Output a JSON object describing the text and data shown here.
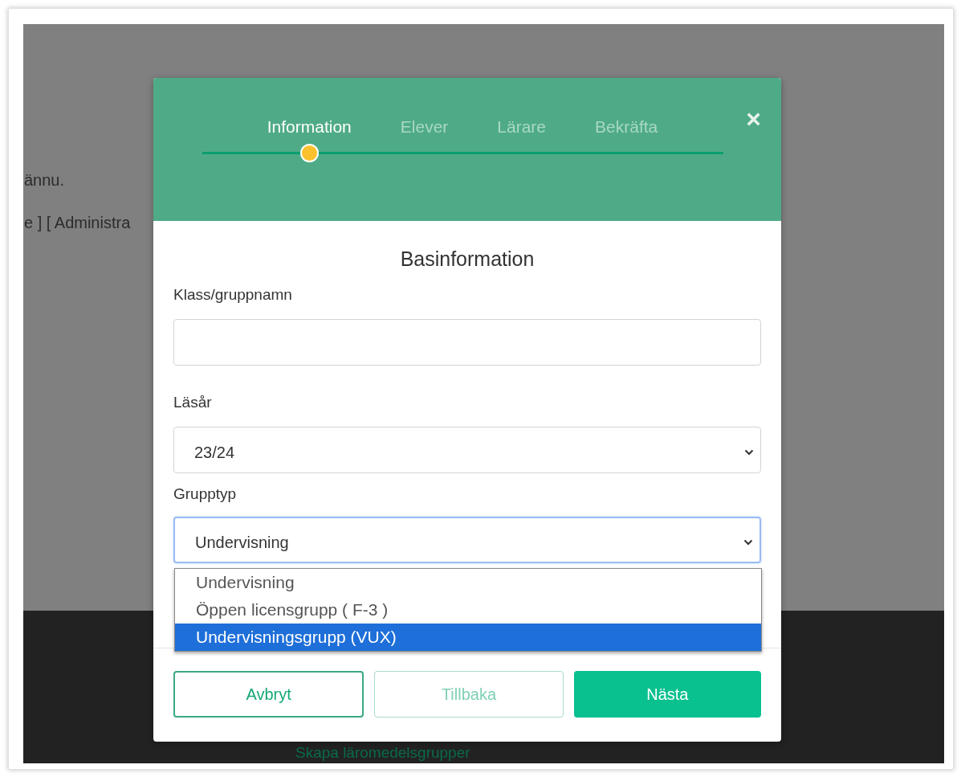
{
  "background": {
    "lines": [
      "ännu.",
      "e ] [ Administra"
    ],
    "link": "Skapa läromedelsgrupper"
  },
  "modal": {
    "steps": [
      {
        "label": "Information",
        "selected": true
      },
      {
        "label": "Elever",
        "selected": false
      },
      {
        "label": "Lärare",
        "selected": false
      },
      {
        "label": "Bekräfta",
        "selected": false
      }
    ],
    "close": "×",
    "heading": "Basinformation",
    "fields": [
      {
        "kind": "text",
        "label": "Klass/gruppnamn",
        "focused": false
      },
      {
        "kind": "select",
        "label": "Läsår",
        "value": "23/24",
        "focused": false
      },
      {
        "kind": "select",
        "label": "Grupptyp",
        "value": "Undervisning",
        "focused": true
      }
    ],
    "dropdown": [
      {
        "label": "Undervisning",
        "selected": false
      },
      {
        "label": "Öppen licensgrupp ( F-3 )",
        "selected": false
      },
      {
        "label": "Undervisningsgrupp (VUX)",
        "selected": true
      }
    ],
    "buttons": [
      {
        "label": "Avbryt",
        "kind": "outline",
        "disabled": false
      },
      {
        "label": "Tillbaka",
        "kind": "outline",
        "disabled": true
      },
      {
        "label": "Nästa",
        "kind": "primary",
        "disabled": false
      }
    ]
  }
}
